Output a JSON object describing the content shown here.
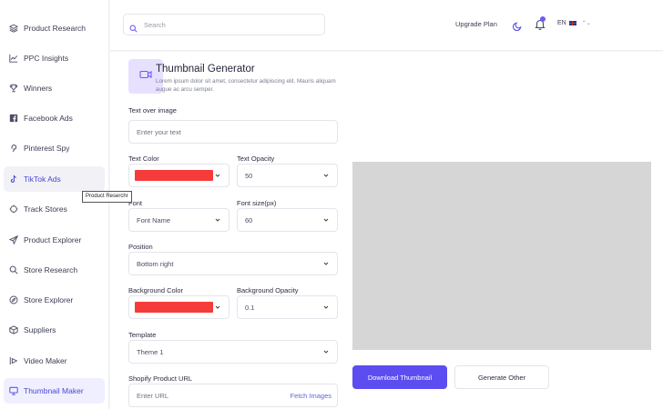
{
  "sidebar": {
    "items": [
      {
        "label": "Product Research",
        "icon": "layers-icon"
      },
      {
        "label": "PPC Insights",
        "icon": "chart-line-icon"
      },
      {
        "label": "Winners",
        "icon": "trophy-icon"
      },
      {
        "label": "Facebook Ads",
        "icon": "facebook-icon"
      },
      {
        "label": "Pinterest Spy",
        "icon": "pinterest-icon"
      },
      {
        "label": "TikTok Ads",
        "icon": "tiktok-icon"
      },
      {
        "label": "Track Stores",
        "icon": "track-icon"
      },
      {
        "label": "Product Explorer",
        "icon": "send-icon"
      },
      {
        "label": "Store Research",
        "icon": "search-icon"
      },
      {
        "label": "Store Explorer",
        "icon": "compass-icon"
      },
      {
        "label": "Suppliers",
        "icon": "box-icon"
      },
      {
        "label": "Video Maker",
        "icon": "video-icon"
      },
      {
        "label": "Thumbnail Maker",
        "icon": "monitor-icon"
      }
    ],
    "tooltip": "Product Reserchr"
  },
  "header": {
    "search_placeholder": "Search",
    "upgrade_label": "Upgrade Plan",
    "language": "EN"
  },
  "page": {
    "title": "Thumbnail Generator",
    "description": "Lorem ipsum dolor sit amet, consectetur adipiscing elit. Mauris aliquam augue ac arcu semper."
  },
  "form": {
    "text_over_image_label": "Text over image",
    "text_over_image_placeholder": "Enter your text",
    "text_color_label": "Text Color",
    "text_color_value": "#f63b3b",
    "text_opacity_label": "Text Opacity",
    "text_opacity_value": "50",
    "font_label": "Font",
    "font_value": "Font Name",
    "font_size_label": "Font size(px)",
    "font_size_value": "60",
    "position_label": "Position",
    "position_value": "Bottom right",
    "background_color_label": "Background Color",
    "background_color_value": "#f63b3b",
    "background_opacity_label": "Background Opacity",
    "background_opacity_value": "0.1",
    "template_label": "Template",
    "template_value": "Theme 1",
    "shopify_url_label": "Shopify Product URL",
    "shopify_url_placeholder": "Enter URL",
    "fetch_label": "Fetch Images"
  },
  "actions": {
    "download_label": "Download Thumbnail",
    "generate_label": "Generate Other"
  },
  "colors": {
    "accent": "#5c4df1",
    "preview_bg": "#d6d6d6"
  }
}
